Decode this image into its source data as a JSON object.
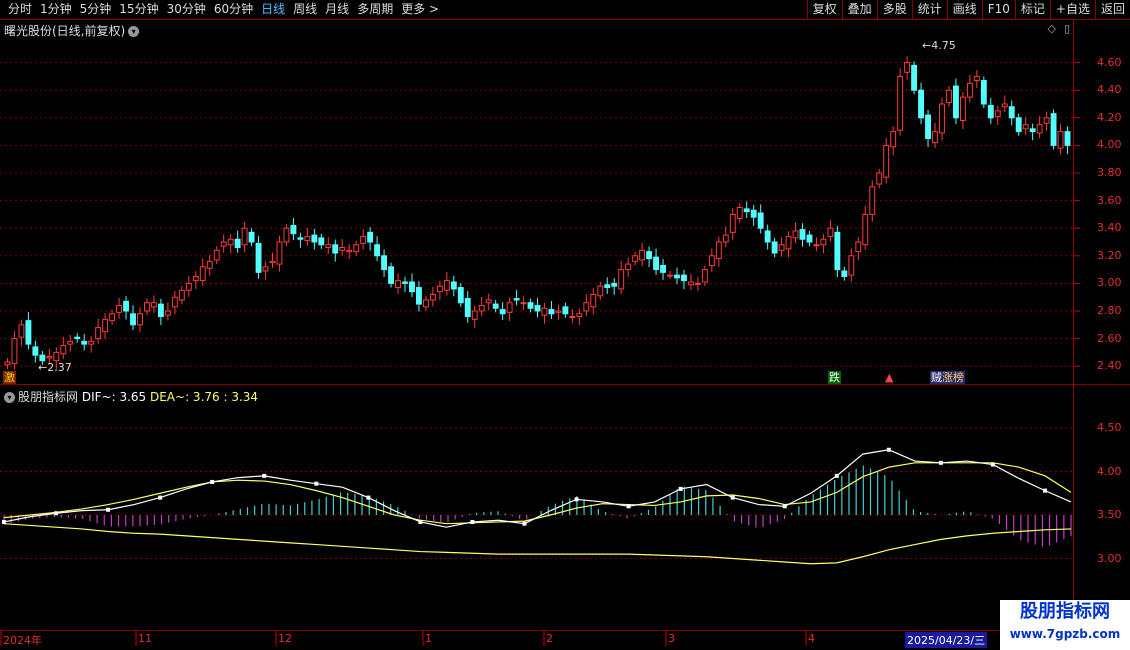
{
  "toolbar": {
    "left": [
      "分时",
      "1分钟",
      "5分钟",
      "15分钟",
      "30分钟",
      "60分钟",
      "日线",
      "周线",
      "月线",
      "多周期",
      "更多 >"
    ],
    "active_index": 6,
    "right": [
      "复权",
      "叠加",
      "多股",
      "统计",
      "画线",
      "F10",
      "标记",
      "+自选",
      "返回"
    ]
  },
  "main_title": "曙光股份(日线,前复权)",
  "indicator_title": "股朋指标网",
  "indicator_values": {
    "dif_label": "DIF~: 3.65",
    "dea_label": "DEA~: 3.76",
    "third_label": ": 3.34"
  },
  "y_ticks_price": [
    "4.60",
    "4.40",
    "4.20",
    "4.00",
    "3.80",
    "3.60",
    "3.40",
    "3.20",
    "3.00",
    "2.80",
    "2.60",
    "2.40"
  ],
  "y_ticks_indicator": [
    "4.50",
    "4.00",
    "3.50",
    "3.00"
  ],
  "x_labels": [
    "2024年",
    "11",
    "12",
    "1",
    "2",
    "3",
    "4",
    "2025/04/23/三"
  ],
  "markers": {
    "high_label": "4.75",
    "low_label": "2.37",
    "m1": "激",
    "m2": "跌",
    "m3": "▲",
    "m4": "贼",
    "m5": "涨榜"
  },
  "watermark": {
    "line1": "股朋指标网",
    "line2": "www.7gpzb.com"
  },
  "colors": {
    "up": "#ff3b3b",
    "down": "#54ffff",
    "grid": "#7a0000",
    "dif": "#ffffff",
    "dea": "#ffff66",
    "third": "#ffff66"
  },
  "chart_data": {
    "type": "candlestick",
    "ylim": [
      2.3,
      4.8
    ],
    "closes": [
      2.43,
      2.6,
      2.7,
      2.56,
      2.48,
      2.44,
      2.47,
      2.5,
      2.55,
      2.58,
      2.6,
      2.56,
      2.58,
      2.68,
      2.74,
      2.78,
      2.84,
      2.8,
      2.7,
      2.78,
      2.86,
      2.86,
      2.76,
      2.8,
      2.9,
      2.95,
      3.0,
      3.05,
      3.12,
      3.16,
      3.24,
      3.3,
      3.32,
      3.26,
      3.4,
      3.3,
      3.08,
      3.12,
      3.16,
      3.3,
      3.4,
      3.36,
      3.32,
      3.34,
      3.3,
      3.28,
      3.28,
      3.22,
      3.26,
      3.24,
      3.28,
      3.34,
      3.3,
      3.2,
      3.1,
      3.0,
      3.02,
      3.0,
      2.94,
      2.85,
      2.88,
      2.92,
      2.98,
      3.02,
      2.96,
      2.86,
      2.76,
      2.8,
      2.84,
      2.88,
      2.82,
      2.78,
      2.86,
      2.88,
      2.86,
      2.82,
      2.8,
      2.82,
      2.78,
      2.8,
      2.78,
      2.76,
      2.78,
      2.86,
      2.92,
      2.98,
      2.97,
      2.98,
      3.1,
      3.14,
      3.2,
      3.24,
      3.18,
      3.1,
      3.08,
      3.06,
      3.04,
      3.02,
      3.01,
      3.0,
      3.1,
      3.2,
      3.3,
      3.35,
      3.5,
      3.55,
      3.52,
      3.48,
      3.4,
      3.3,
      3.22,
      3.28,
      3.34,
      3.38,
      3.32,
      3.3,
      3.28,
      3.32,
      3.4,
      3.1,
      3.05,
      3.2,
      3.3,
      3.5,
      3.7,
      3.8,
      4.0,
      4.1,
      4.5,
      4.6,
      4.4,
      4.2,
      4.05,
      4.1,
      4.3,
      4.4,
      4.2,
      4.35,
      4.45,
      4.5,
      4.3,
      4.2,
      4.25,
      4.3,
      4.2,
      4.1,
      4.15,
      4.1,
      4.15,
      4.2,
      4.0,
      4.1,
      4.0
    ],
    "indicator": {
      "dif": [
        3.42,
        3.48,
        3.52,
        3.55,
        3.56,
        3.62,
        3.7,
        3.8,
        3.88,
        3.93,
        3.95,
        3.9,
        3.86,
        3.82,
        3.7,
        3.55,
        3.42,
        3.36,
        3.42,
        3.44,
        3.4,
        3.55,
        3.68,
        3.65,
        3.6,
        3.65,
        3.8,
        3.85,
        3.7,
        3.62,
        3.6,
        3.75,
        3.95,
        4.2,
        4.25,
        4.12,
        4.1,
        4.12,
        4.08,
        3.92,
        3.78,
        3.65
      ],
      "dea": [
        3.47,
        3.5,
        3.53,
        3.57,
        3.62,
        3.68,
        3.75,
        3.82,
        3.88,
        3.9,
        3.89,
        3.85,
        3.78,
        3.7,
        3.6,
        3.5,
        3.44,
        3.4,
        3.41,
        3.42,
        3.43,
        3.5,
        3.58,
        3.63,
        3.62,
        3.61,
        3.65,
        3.72,
        3.73,
        3.69,
        3.62,
        3.65,
        3.76,
        3.94,
        4.05,
        4.1,
        4.1,
        4.1,
        4.1,
        4.05,
        3.95,
        3.76
      ],
      "third": [
        3.4,
        3.38,
        3.36,
        3.34,
        3.31,
        3.29,
        3.28,
        3.26,
        3.24,
        3.22,
        3.2,
        3.18,
        3.16,
        3.14,
        3.12,
        3.1,
        3.08,
        3.07,
        3.06,
        3.05,
        3.05,
        3.05,
        3.05,
        3.05,
        3.05,
        3.04,
        3.03,
        3.02,
        3.0,
        2.98,
        2.96,
        2.94,
        2.95,
        3.02,
        3.1,
        3.16,
        3.22,
        3.26,
        3.29,
        3.31,
        3.33,
        3.34
      ]
    }
  }
}
